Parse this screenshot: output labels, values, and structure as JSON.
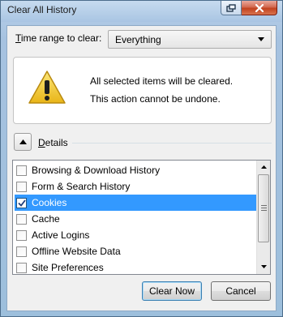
{
  "window": {
    "title": "Clear All History"
  },
  "time_range": {
    "label_prefix": "T",
    "label_rest": "ime range to clear:",
    "selected": "Everything"
  },
  "warning": {
    "line1": "All selected items will be cleared.",
    "line2": "This action cannot be undone.",
    "icon": "warning-icon"
  },
  "details": {
    "label_prefix": "D",
    "label_rest": "etails",
    "expanded": true
  },
  "items": [
    {
      "label": "Browsing & Download History",
      "checked": false,
      "selected": false
    },
    {
      "label": "Form & Search History",
      "checked": false,
      "selected": false
    },
    {
      "label": "Cookies",
      "checked": true,
      "selected": true
    },
    {
      "label": "Cache",
      "checked": false,
      "selected": false
    },
    {
      "label": "Active Logins",
      "checked": false,
      "selected": false
    },
    {
      "label": "Offline Website Data",
      "checked": false,
      "selected": false
    },
    {
      "label": "Site Preferences",
      "checked": false,
      "selected": false
    }
  ],
  "buttons": {
    "clear_now": "Clear Now",
    "cancel": "Cancel"
  }
}
